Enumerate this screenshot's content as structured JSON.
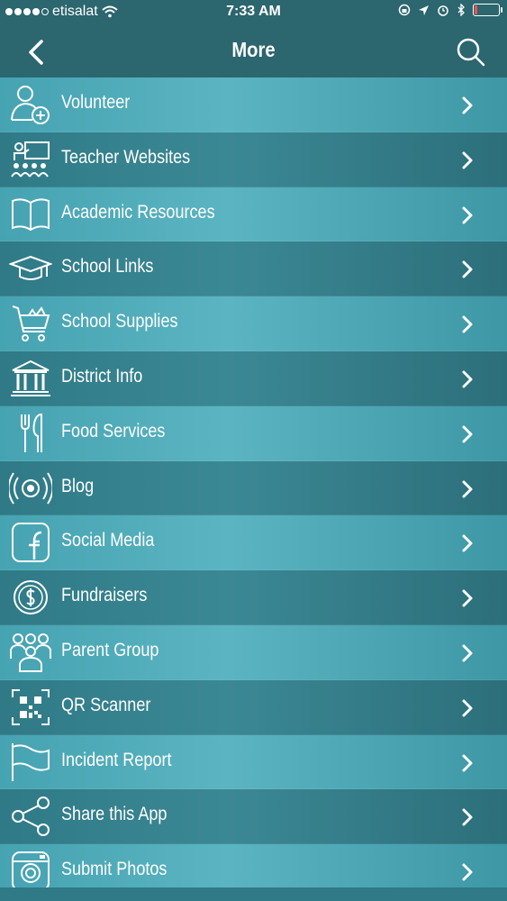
{
  "status_bar": {
    "carrier": "etisalat",
    "time": "7:33 AM",
    "signal_bars_filled": 4,
    "signal_bars_total": 5,
    "battery_level": 0.1
  },
  "nav": {
    "title": "More",
    "back_icon": "chevron-left-icon",
    "search_icon": "search-icon"
  },
  "menu": {
    "items": [
      {
        "label": "Volunteer",
        "icon": "volunteer-icon"
      },
      {
        "label": "Teacher Websites",
        "icon": "teacher-icon"
      },
      {
        "label": "Academic Resources",
        "icon": "book-icon"
      },
      {
        "label": "School Links",
        "icon": "graduation-cap-icon"
      },
      {
        "label": "School Supplies",
        "icon": "shopping-cart-icon"
      },
      {
        "label": "District Info",
        "icon": "building-icon"
      },
      {
        "label": "Food Services",
        "icon": "fork-knife-icon"
      },
      {
        "label": "Blog",
        "icon": "broadcast-icon"
      },
      {
        "label": "Social Media",
        "icon": "facebook-icon"
      },
      {
        "label": "Fundraisers",
        "icon": "dollar-coin-icon"
      },
      {
        "label": "Parent Group",
        "icon": "group-icon"
      },
      {
        "label": "QR Scanner",
        "icon": "qr-code-icon"
      },
      {
        "label": "Incident Report",
        "icon": "flag-icon"
      },
      {
        "label": "Share this App",
        "icon": "share-icon"
      },
      {
        "label": "Submit Photos",
        "icon": "camera-icon"
      }
    ]
  },
  "colors": {
    "header_bg": "#2c666f",
    "row_light": "#4aa7b5",
    "row_dark": "#327d89",
    "text": "#ffffff",
    "battery_low": "#ff4f4f"
  }
}
